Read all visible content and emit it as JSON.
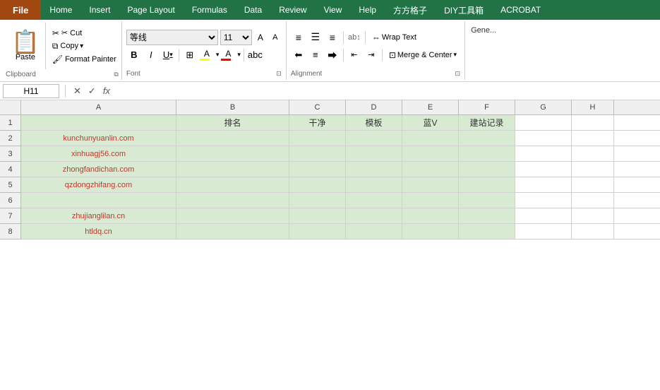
{
  "menubar": {
    "file_label": "File",
    "tabs": [
      "Home",
      "Insert",
      "Page Layout",
      "Formulas",
      "Data",
      "Review",
      "View",
      "Help",
      "方方格子",
      "DIY工具箱",
      "ACROBAT"
    ]
  },
  "ribbon": {
    "clipboard": {
      "paste_label": "Paste",
      "cut_label": "✂ Cut",
      "copy_label": "Copy",
      "format_painter_label": "Format Painter",
      "group_label": "Clipboard"
    },
    "font": {
      "font_name": "等线",
      "font_size": "11",
      "bold_label": "B",
      "italic_label": "I",
      "underline_label": "U",
      "group_label": "Font"
    },
    "alignment": {
      "wrap_text_label": "Wrap Text",
      "merge_center_label": "Merge & Center",
      "group_label": "Alignment"
    },
    "general": {
      "label": "Gene..."
    }
  },
  "formula_bar": {
    "cell_ref": "H11",
    "formula_text": ""
  },
  "grid": {
    "columns": [
      "A",
      "B",
      "C",
      "D",
      "E",
      "F",
      "G",
      "H"
    ],
    "headers": {
      "b": "排名",
      "c": "干净",
      "d": "模板",
      "e": "蓝V",
      "f": "建站记录"
    },
    "rows": [
      {
        "row": 1,
        "a": "",
        "b": "排名",
        "c": "干净",
        "d": "模板",
        "e": "蓝V",
        "f": "建站记录",
        "g": "",
        "h": ""
      },
      {
        "row": 2,
        "a": "kunchunyuanlin.com",
        "b": "",
        "c": "",
        "d": "",
        "e": "",
        "f": "",
        "g": "",
        "h": ""
      },
      {
        "row": 3,
        "a": "xinhuagj56.com",
        "b": "",
        "c": "",
        "d": "",
        "e": "",
        "f": "",
        "g": "",
        "h": ""
      },
      {
        "row": 4,
        "a": "zhongfandichan.com",
        "b": "",
        "c": "",
        "d": "",
        "e": "",
        "f": "",
        "g": "",
        "h": ""
      },
      {
        "row": 5,
        "a": "qzdongzhifang.com",
        "b": "",
        "c": "",
        "d": "",
        "e": "",
        "f": "",
        "g": "",
        "h": ""
      },
      {
        "row": 6,
        "a": "",
        "b": "",
        "c": "",
        "d": "",
        "e": "",
        "f": "",
        "g": "",
        "h": ""
      },
      {
        "row": 7,
        "a": "zhujianglilan.cn",
        "b": "",
        "c": "",
        "d": "",
        "e": "",
        "f": "",
        "g": "",
        "h": ""
      },
      {
        "row": 8,
        "a": "htldq.cn",
        "b": "",
        "c": "",
        "d": "",
        "e": "",
        "f": "",
        "g": "",
        "h": ""
      }
    ]
  }
}
